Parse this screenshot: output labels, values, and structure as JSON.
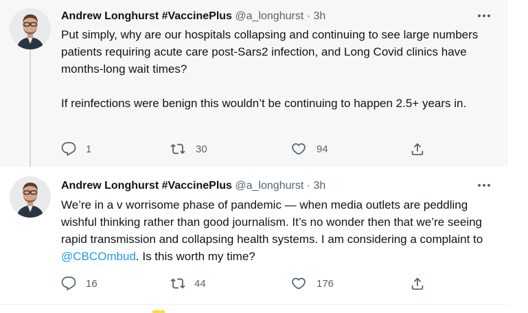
{
  "tweets": [
    {
      "author_name": "Andrew Longhurst #VaccinePlus",
      "handle": "@a_longhurst",
      "separator": "·",
      "time": "3h",
      "paragraphs": [
        "Put simply, why are our hospitals collapsing and continuing to see large numbers patients requiring acute care post-Sars2 infection, and Long Covid clinics have months-long wait times?",
        "If reinfections were benign this wouldn’t be continuing to happen 2.5+ years in."
      ],
      "replies": "1",
      "retweets": "30",
      "likes": "94"
    },
    {
      "author_name": "Andrew Longhurst #VaccinePlus",
      "handle": "@a_longhurst",
      "separator": "·",
      "time": "3h",
      "text_before_mention": "We’re in a v worrisome phase of pandemic — when media outlets are peddling wishful thinking rather than good journalism. It’s no wonder then that we’re seeing rapid transmission and collapsing health systems. I am considering a complaint to ",
      "mention": "@CBCOmbud",
      "text_after_mention": ". Is this worth my time?",
      "replies": "16",
      "retweets": "44",
      "likes": "176"
    }
  ],
  "icons": {
    "reply": "reply-icon",
    "retweet": "retweet-icon",
    "like": "heart-icon",
    "share": "share-icon",
    "more": "more-options-icon"
  },
  "colors": {
    "accent": "#1d9bf0",
    "secondary_text": "#536471",
    "highlight_bg": "#f7f7f7"
  }
}
